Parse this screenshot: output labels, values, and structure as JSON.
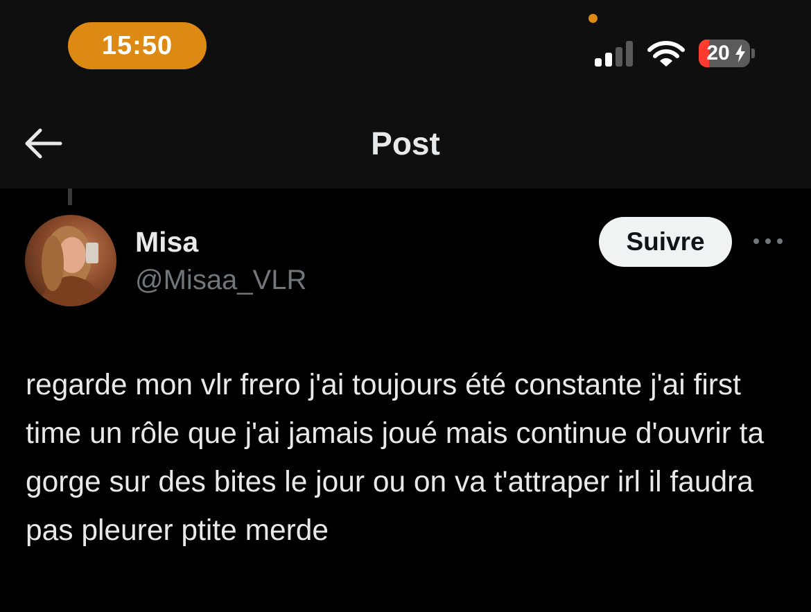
{
  "status_bar": {
    "time": "15:50",
    "battery_percent": "20",
    "battery_level": 0.2,
    "signal_bars_active": 2,
    "signal_bars_total": 4,
    "accent_color": "#dd8a14",
    "battery_low_color": "#ff3b30"
  },
  "header": {
    "title": "Post",
    "back_icon": "arrow-left-icon"
  },
  "post": {
    "author": {
      "display_name": "Misa",
      "handle": "@Misaa_VLR"
    },
    "follow_label": "Suivre",
    "more_icon": "more-horizontal-icon",
    "text": "regarde mon vlr frero j'ai toujours été constante j'ai first time un rôle que j'ai jamais joué mais continue d'ouvrir ta gorge sur des bites le jour ou on va t'attraper irl il faudra pas pleurer ptite merde"
  }
}
